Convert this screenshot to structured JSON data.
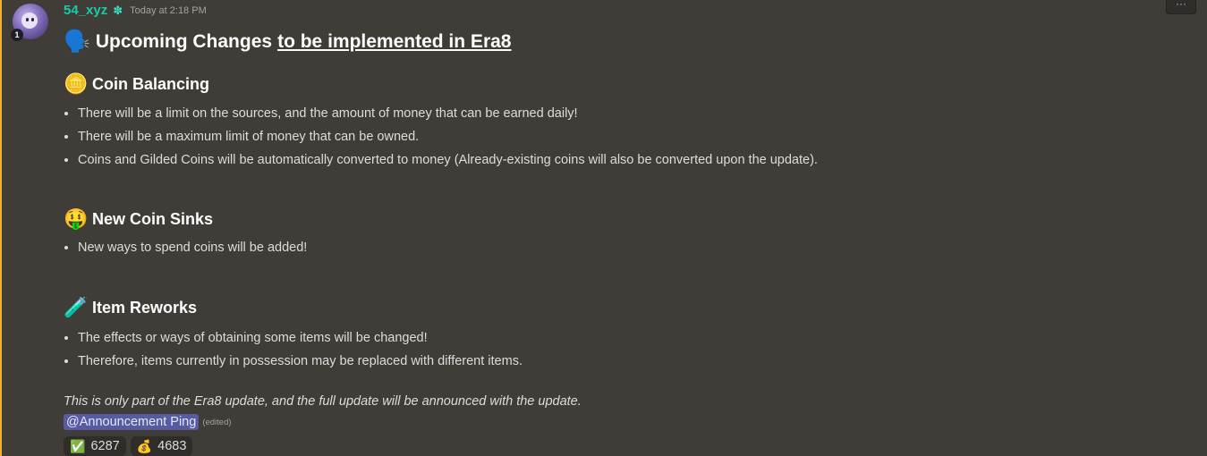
{
  "message": {
    "username": "54_xyz",
    "role_icon": "gear-icon",
    "role_glyph": "✽",
    "timestamp": "Today at 2:18 PM",
    "avatar_badge": "1",
    "title": {
      "emoji": "🗣️",
      "plain": "Upcoming Changes",
      "underlined": "to be implemented in Era8"
    },
    "sections": [
      {
        "emoji": "🪙",
        "heading": "Coin Balancing",
        "bullets": [
          "There will be a limit on the sources, and the amount of money that can be earned daily!",
          "There will be a maximum limit of money that can be owned.",
          "Coins and Gilded Coins will be automatically converted to money (Already-existing coins will also be converted upon the update)."
        ]
      },
      {
        "emoji": "🤑",
        "heading": "New Coin Sinks",
        "bullets": [
          "New ways to spend coins will be added!"
        ]
      },
      {
        "emoji": "🧪",
        "heading": "Item Reworks",
        "bullets": [
          "The effects or ways of obtaining some items will be changed!",
          "Therefore, items currently in possession may be replaced with different items."
        ]
      }
    ],
    "footer_note": "This is only part of the Era8 update, and the full update will be announced with the update.",
    "mention": "@Announcement Ping",
    "edited_label": "(edited)",
    "reactions": [
      {
        "emoji": "✅",
        "count": "6287"
      },
      {
        "emoji": "💰",
        "count": "4683"
      }
    ],
    "more_button_glyph": "···"
  },
  "colors": {
    "background": "#403c37",
    "username": "#1cc9a8",
    "mention_bg": "#585b9f",
    "highlight_bar": "#f0b232"
  }
}
